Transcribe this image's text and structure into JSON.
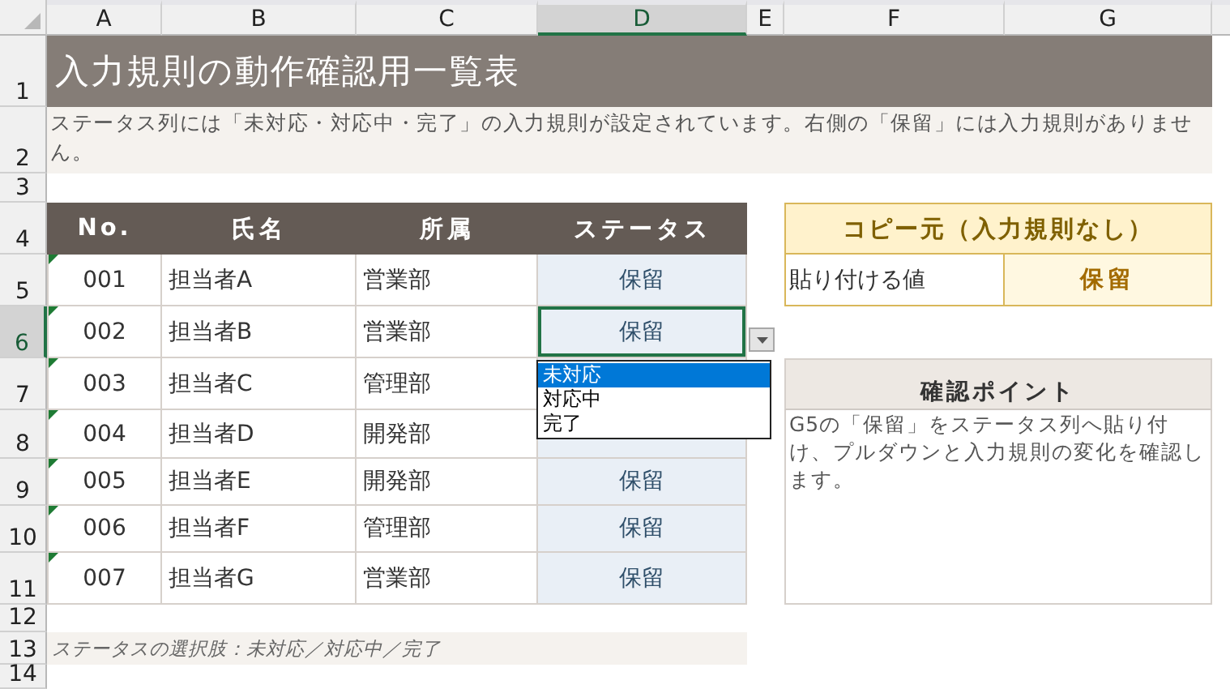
{
  "columns": [
    {
      "label": "A",
      "selected": false
    },
    {
      "label": "B",
      "selected": false
    },
    {
      "label": "C",
      "selected": false
    },
    {
      "label": "D",
      "selected": true
    },
    {
      "label": "E",
      "selected": false
    },
    {
      "label": "F",
      "selected": false
    },
    {
      "label": "G",
      "selected": false
    }
  ],
  "row_numbers": [
    {
      "label": "1",
      "selected": false
    },
    {
      "label": "2",
      "selected": false
    },
    {
      "label": "3",
      "selected": false
    },
    {
      "label": "4",
      "selected": false
    },
    {
      "label": "5",
      "selected": false
    },
    {
      "label": "6",
      "selected": true
    },
    {
      "label": "7",
      "selected": false
    },
    {
      "label": "8",
      "selected": false
    },
    {
      "label": "9",
      "selected": false
    },
    {
      "label": "10",
      "selected": false
    },
    {
      "label": "11",
      "selected": false
    },
    {
      "label": "12",
      "selected": false
    },
    {
      "label": "13",
      "selected": false
    },
    {
      "label": "14",
      "selected": false
    }
  ],
  "title": "入力規則の動作確認用一覧表",
  "note": "ステータス列には「未対応・対応中・完了」の入力規則が設定されています。右側の「保留」には入力規則がありません。",
  "table": {
    "columns": [
      "No.",
      "氏名",
      "所属",
      "ステータス"
    ],
    "rows": [
      {
        "no": "001",
        "name": "担当者A",
        "dept": "営業部",
        "status": "保留",
        "error_indicator": true,
        "selected": false
      },
      {
        "no": "002",
        "name": "担当者B",
        "dept": "営業部",
        "status": "保留",
        "error_indicator": true,
        "selected": true
      },
      {
        "no": "003",
        "name": "担当者C",
        "dept": "管理部",
        "error_indicator": true,
        "selected": false
      },
      {
        "no": "004",
        "name": "担当者D",
        "dept": "開発部",
        "error_indicator": true,
        "selected": false
      },
      {
        "no": "005",
        "name": "担当者E",
        "dept": "開発部",
        "status": "保留",
        "error_indicator": true,
        "selected": false
      },
      {
        "no": "006",
        "name": "担当者F",
        "dept": "管理部",
        "status": "保留",
        "error_indicator": true,
        "selected": false
      },
      {
        "no": "007",
        "name": "担当者G",
        "dept": "営業部",
        "status": "保留",
        "error_indicator": true,
        "selected": false
      }
    ]
  },
  "dropdown": {
    "options": [
      {
        "label": "未対応",
        "selected": true
      },
      {
        "label": "対応中",
        "selected": false
      },
      {
        "label": "完了",
        "selected": false
      }
    ]
  },
  "copy_source": {
    "title": "コピー元（入力規則なし）",
    "label": "貼り付ける値",
    "value": "保留"
  },
  "check_point": {
    "title": "確認ポイント",
    "body": "G5の「保留」をステータス列へ貼り付け、プルダウンと入力規則の変化を確認します。"
  },
  "caption": "ステータスの選択肢：未対応／対応中／完了"
}
